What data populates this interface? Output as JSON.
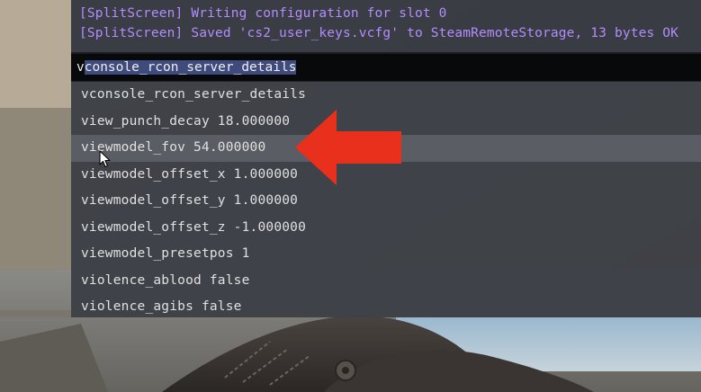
{
  "colors": {
    "log_text": "#b48cff",
    "input_bg": "#08090b",
    "selection_bg": "#3f4b7c",
    "dropdown_bg": "#3c3f46",
    "hover_row_bg": "#5a5d63",
    "arrow_red": "#e8301c"
  },
  "console": {
    "log": [
      "[SplitScreen] Writing configuration for slot 0",
      "[SplitScreen] Saved 'cs2_user_keys.vcfg' to SteamRemoteStorage, 13 bytes OK"
    ],
    "input": {
      "typed_first_char": "v",
      "selected_text": "console_rcon_server_details"
    },
    "suggestions": [
      "vconsole_rcon_server_details",
      "view_punch_decay 18.000000",
      "viewmodel_fov 54.000000",
      "viewmodel_offset_x 1.000000",
      "viewmodel_offset_y 1.000000",
      "viewmodel_offset_z -1.000000",
      "viewmodel_presetpos 1",
      "violence_ablood false",
      "violence_agibs false"
    ],
    "hovered_index": 2
  },
  "icons": {
    "arrow": "left-arrow-icon",
    "cursor": "mouse-pointer-icon"
  }
}
